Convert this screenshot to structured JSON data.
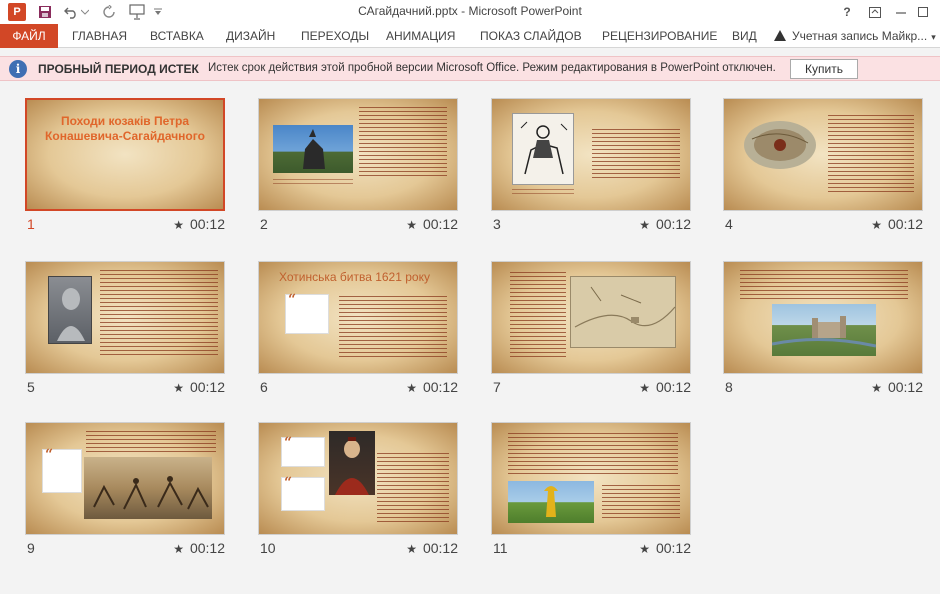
{
  "window": {
    "title": "САгайдачний.pptx - Microsoft PowerPoint",
    "app_icon_letter": "P",
    "help": "?"
  },
  "ribbon": {
    "tabs": [
      "ФАЙЛ",
      "ГЛАВНАЯ",
      "ВСТАВКА",
      "ДИЗАЙН",
      "ПЕРЕХОДЫ",
      "АНИМАЦИЯ",
      "ПОКАЗ СЛАЙДОВ",
      "РЕЦЕНЗИРОВАНИЕ",
      "ВИД"
    ],
    "account": "Учетная запись Майкр..."
  },
  "message_bar": {
    "title": "ПРОБНЫЙ ПЕРИОД ИСТЕК",
    "text": "Истек срок действия этой пробной версии Microsoft Office. Режим редактирования в PowerPoint отключен.",
    "button": "Купить",
    "icon": "info-icon"
  },
  "slides": [
    {
      "number": "1",
      "time": "00:12",
      "title": "Походи козаків Петра Конашевича-Сагайдачного",
      "selected": true
    },
    {
      "number": "2",
      "time": "00:12"
    },
    {
      "number": "3",
      "time": "00:12"
    },
    {
      "number": "4",
      "time": "00:12"
    },
    {
      "number": "5",
      "time": "00:12"
    },
    {
      "number": "6",
      "time": "00:12",
      "title": "Хотинська битва 1621 року"
    },
    {
      "number": "7",
      "time": "00:12"
    },
    {
      "number": "8",
      "time": "00:12"
    },
    {
      "number": "9",
      "time": "00:12"
    },
    {
      "number": "10",
      "time": "00:12"
    },
    {
      "number": "11",
      "time": "00:12"
    }
  ],
  "colors": {
    "accent": "#d24726",
    "message_bar_bg": "#fbe1e3",
    "info_icon": "#3f6fb3",
    "slide_title": "#e0662b"
  }
}
